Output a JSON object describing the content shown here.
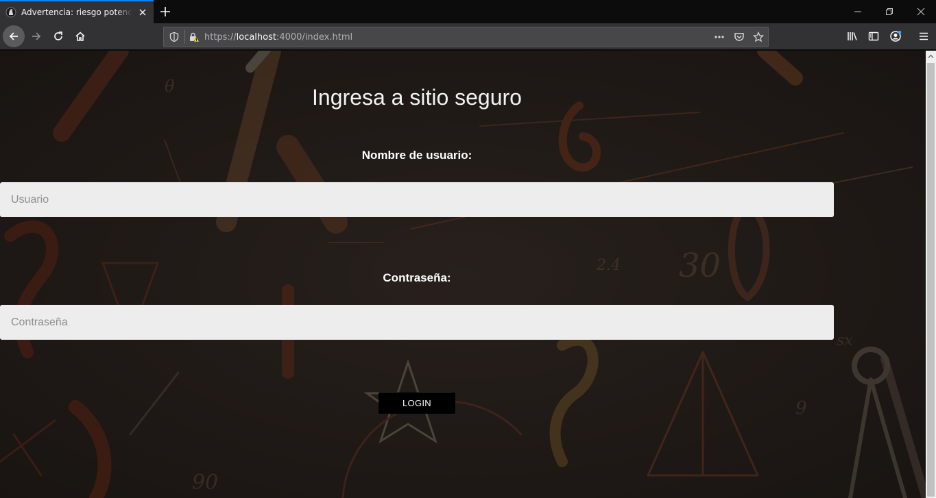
{
  "browser": {
    "tab": {
      "title": "Advertencia: riesgo potencial de seguridad a continuación"
    },
    "urlbar": {
      "scheme": "https://",
      "host": "localhost",
      "rest": ":4000/index.html"
    },
    "icons": {
      "favicon": "warning-favicon-icon",
      "tab_close": "close-icon",
      "new_tab": "plus-icon",
      "minimize": "minimize-icon",
      "restore": "restore-icon",
      "close_window": "close-window-icon",
      "back": "back-arrow-icon",
      "forward": "forward-arrow-icon",
      "reload": "reload-icon",
      "home": "home-icon",
      "tracking": "shield-icon",
      "insecure": "insecure-lock-icon",
      "page_actions": "more-icon",
      "pocket": "pocket-icon",
      "bookmark": "star-icon",
      "library": "library-icon",
      "sidebar": "sidebar-icon",
      "account": "account-icon",
      "menu": "hamburger-menu-icon"
    }
  },
  "page": {
    "title": "Ingresa a sitio seguro",
    "username": {
      "label": "Nombre de usuario:",
      "placeholder": "Usuario",
      "value": ""
    },
    "password": {
      "label": "Contraseña:",
      "placeholder": "Contraseña",
      "value": ""
    },
    "login_button": "LOGIN"
  },
  "colors": {
    "tab_accent": "#0a84ff",
    "toolbar": "#323234",
    "page_bg": "#1f1a18",
    "input_bg": "#ededed",
    "button_bg": "#000000"
  }
}
